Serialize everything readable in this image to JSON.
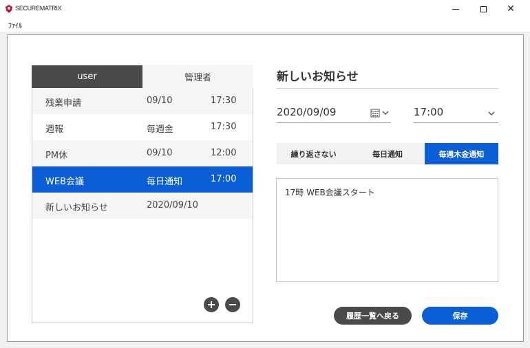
{
  "window": {
    "title": "SECUREMATRIX",
    "minimize_icon": "minimize-icon",
    "maximize_icon": "maximize-icon",
    "close_glyph": "✕"
  },
  "menu": {
    "file": "ﾌｧｲﾙ"
  },
  "tabs": {
    "user": "user",
    "admin": "管理者"
  },
  "list": {
    "rows": [
      {
        "name": "残業申請",
        "date": "09/10",
        "time": "17:30"
      },
      {
        "name": "週報",
        "date": "毎週金",
        "time": "17:30"
      },
      {
        "name": "PM休",
        "date": "09/10",
        "time": "12:00"
      },
      {
        "name": "WEB会議",
        "date": "毎日通知",
        "time": "17:00"
      },
      {
        "name": "新しいお知らせ",
        "date": "2020/09/10",
        "time": ""
      }
    ],
    "selected_index": 3
  },
  "form": {
    "title": "新しいお知らせ",
    "date": "2020/09/09",
    "time": "17:00",
    "repeat_options": [
      "繰り返さない",
      "毎日通知",
      "毎週木金通知"
    ],
    "repeat_selected": 2,
    "message": "17時 WEB会議スタート"
  },
  "buttons": {
    "back": "履歴一覧へ戻る",
    "save": "保存"
  },
  "colors": {
    "accent": "#0b5fd6",
    "dark": "#4a4a4a"
  }
}
